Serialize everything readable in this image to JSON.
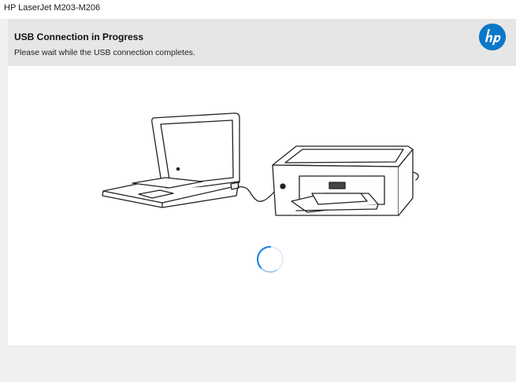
{
  "window": {
    "title": "HP LaserJet M203-M206"
  },
  "header": {
    "heading": "USB Connection in Progress",
    "subheading": "Please wait while the USB connection completes.",
    "logo_icon": "hp-logo-icon",
    "logo_color": "#0a78c8"
  },
  "content": {
    "illustration": [
      "laptop-icon",
      "usb-cable-icon",
      "printer-icon"
    ],
    "spinner_icon": "loading-spinner-icon",
    "spinner_color": "#1e88e5"
  }
}
